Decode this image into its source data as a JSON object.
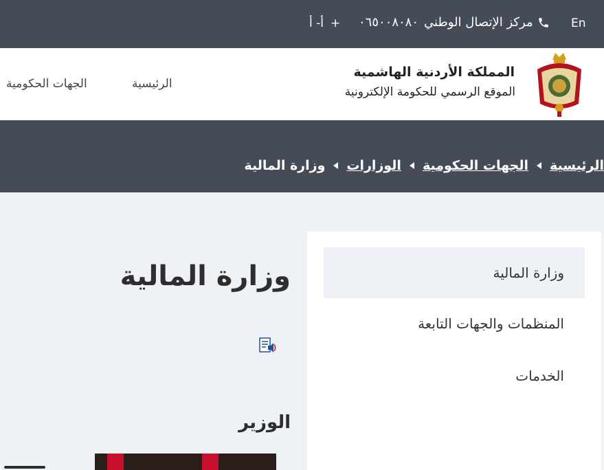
{
  "topbar": {
    "lang_label": "En",
    "call_center_label": "مركز الإتصال الوطني",
    "call_center_number": "٠٦٥٠٠٨٠٨٠",
    "font_increase": "أ+",
    "font_decrease": "أ-"
  },
  "header": {
    "site_title": "المملكة الأردنية الهاشمية",
    "site_subtitle": "الموقع الرسمي للحكومة الإلكترونية",
    "nav": {
      "home": "الرئيسية",
      "gov_entities": "الجهات الحكومية"
    }
  },
  "breadcrumb": {
    "items": [
      "الرئيسية",
      "الجهات الحكومية",
      "الوزارات"
    ],
    "current": "وزارة المالية"
  },
  "side_menu": {
    "items": [
      "وزارة المالية",
      "المنظمات والجهات التابعة",
      "الخدمات"
    ],
    "active_index": 0
  },
  "main": {
    "title": "وزارة المالية",
    "minister_heading": "الوزير"
  },
  "icons": {
    "phone": "phone-icon",
    "crest": "jordan-crest-icon",
    "speaker": "text-to-speech-icon",
    "breadcrumb_separator": "caret-left-icon"
  },
  "colors": {
    "topbar_bg": "#454b57",
    "page_bg": "#eef1f6",
    "flag_red": "#c8102e"
  }
}
